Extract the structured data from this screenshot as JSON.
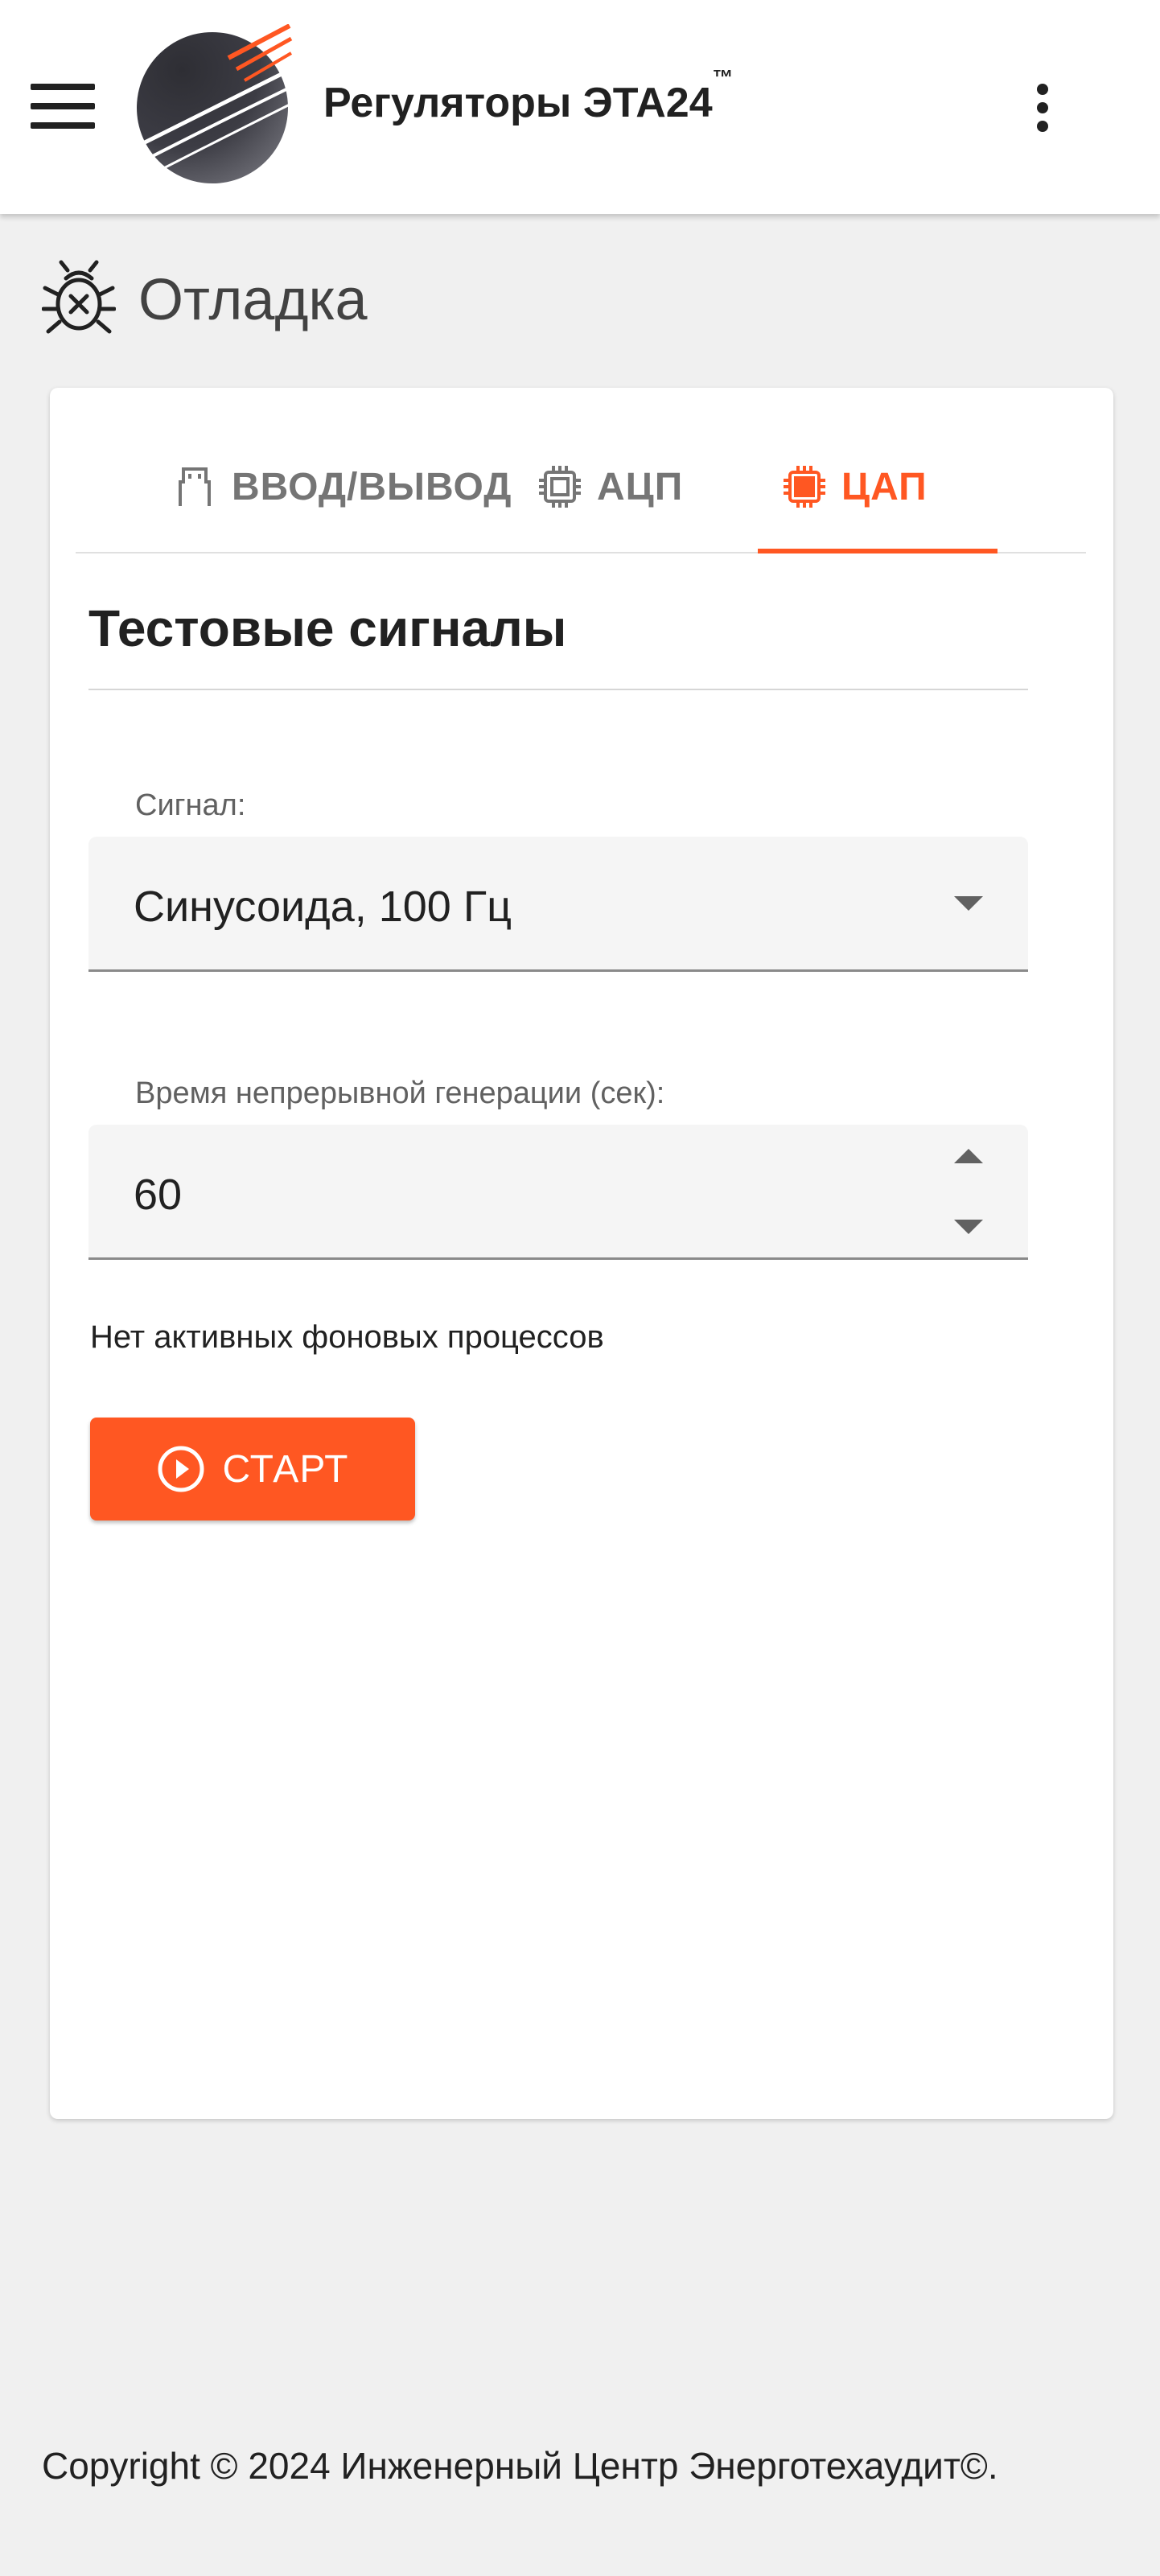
{
  "app": {
    "title": "Регуляторы ЭТА24",
    "trademark": "™"
  },
  "page": {
    "title": "Отладка"
  },
  "tabs": [
    {
      "label": "ВВОД/ВЫВОД",
      "icon": "usb-port-icon",
      "active": false
    },
    {
      "label": "АЦП",
      "icon": "chip-outline-icon",
      "active": false
    },
    {
      "label": "ЦАП",
      "icon": "chip-filled-icon",
      "active": true
    }
  ],
  "section": {
    "title": "Тестовые сигналы"
  },
  "signal_field": {
    "label": "Сигнал:",
    "value": "Синусоида, 100 Гц"
  },
  "duration_field": {
    "label": "Время непрерывной генерации (сек):",
    "value": "60"
  },
  "status": {
    "text": "Нет активных фоновых процессов"
  },
  "start_button": {
    "label": "СТАРТ"
  },
  "footer": {
    "text": "Copyright © 2024 Инженерный Центр Энерготехаудит©."
  },
  "colors": {
    "accent": "#ff5722",
    "background": "#f0f0f0",
    "card": "#ffffff",
    "text": "#212121",
    "muted": "#757575"
  }
}
